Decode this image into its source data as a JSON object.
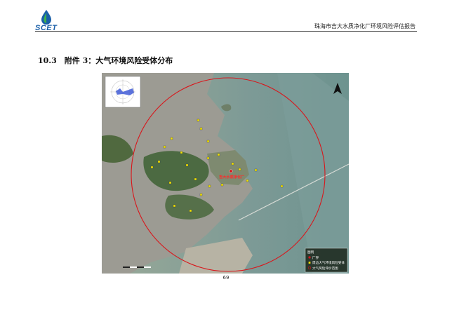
{
  "header": {
    "logo_text": "SCET",
    "report_title": "珠海市吉大水质净化厂环境风险评估报告"
  },
  "section": {
    "title": "10.3　附件 3：大气环境风险受体分布"
  },
  "map": {
    "plant_label": "吉大水质净化厂",
    "receptor_labels": [
      "",
      "",
      "",
      "",
      "",
      "",
      "",
      "",
      "",
      "",
      "",
      "",
      "",
      "",
      "",
      "",
      "",
      "",
      "",
      "",
      "",
      "",
      ""
    ],
    "legend": {
      "title": "图例",
      "items": [
        {
          "label": "厂界",
          "icon": "red-dot-icon",
          "color": "#d9161b"
        },
        {
          "label": "周边大气环境风险受体",
          "icon": "yellow-square-icon",
          "color": "#f5e400"
        },
        {
          "label": "大气风险评价范围",
          "icon": "red-circle-icon",
          "color": "#d9161b"
        }
      ]
    },
    "colors": {
      "risk_circle": "#d9161b",
      "receptor": "#f5e400",
      "sea": "#8aa39c",
      "land": "#9a9a94"
    }
  },
  "footer": {
    "page_number": "69"
  }
}
